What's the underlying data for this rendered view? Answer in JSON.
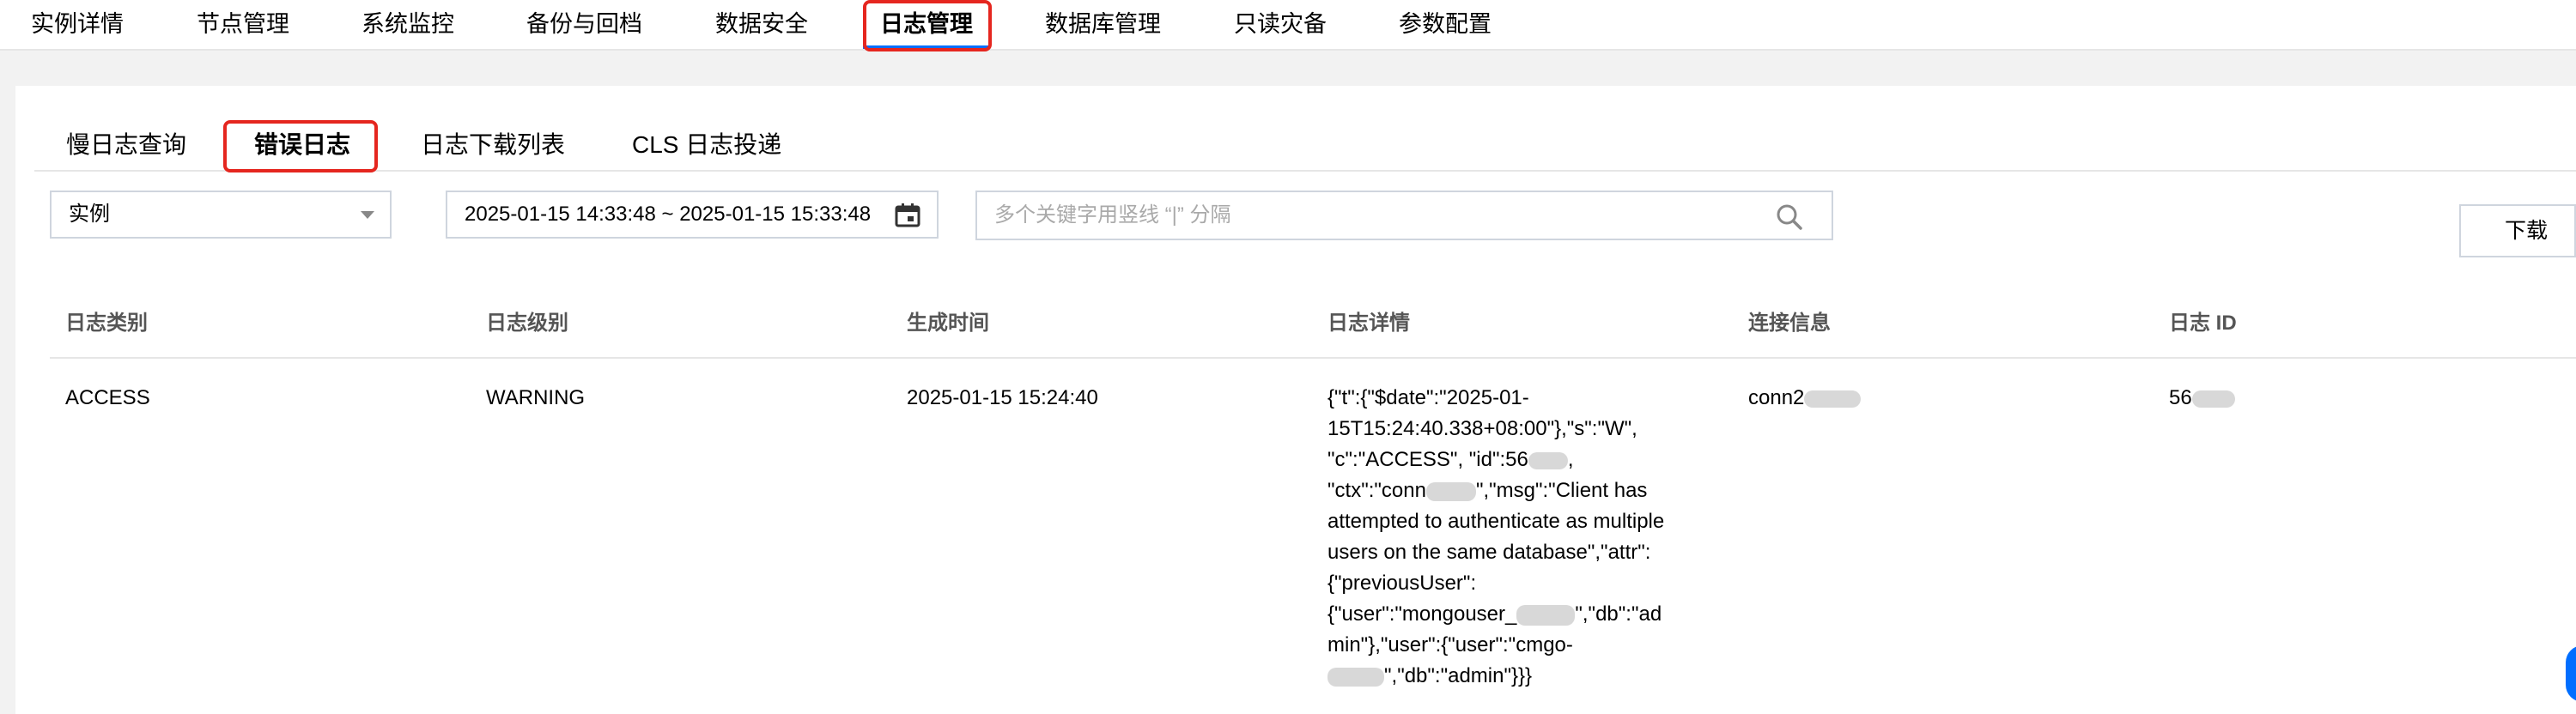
{
  "top_nav": {
    "items": [
      "实例详情",
      "节点管理",
      "系统监控",
      "备份与回档",
      "数据安全",
      "日志管理",
      "数据库管理",
      "只读灾备",
      "参数配置"
    ],
    "active_index": 5
  },
  "sub_tabs": {
    "items": [
      "慢日志查询",
      "错误日志",
      "日志下载列表",
      "CLS 日志投递"
    ],
    "active_index": 1
  },
  "filters": {
    "instance_select": "实例",
    "date_range": "2025-01-15 14:33:48 ~ 2025-01-15 15:33:48",
    "search_placeholder": "多个关键字用竖线 “|” 分隔",
    "download_label": "下载"
  },
  "table": {
    "headers": [
      "日志类别",
      "日志级别",
      "生成时间",
      "日志详情",
      "连接信息",
      "日志 ID"
    ],
    "rows": [
      {
        "category": "ACCESS",
        "level": "WARNING",
        "time": "2025-01-15 15:24:40",
        "detail_lines": [
          "{\"t\":{\"$date\":\"2025-01-",
          "15T15:24:40.338+08:00\"},\"s\":\"W\",",
          "\"c\":\"ACCESS\", \"id\":56",
          "\"ctx\":\"conn",
          "attempted to authenticate as multiple",
          "users on the same database\",\"attr\":",
          "{\"previousUser\":",
          "{\"user\":\"mongouser_",
          "min\"},\"user\":{\"user\":\"cmgo-",
          "\",\"db\":\"admin\"}}}"
        ],
        "detail_line_tails": [
          "",
          "",
          ",",
          "\",\"msg\":\"Client has",
          "",
          "",
          "",
          "\",\"db\":\"ad",
          "",
          ""
        ],
        "connection": "conn2",
        "log_id": "56"
      }
    ]
  },
  "colors": {
    "active_underline": "#006eff",
    "highlight_box": "#e5261f",
    "page_bg": "#f2f2f2"
  },
  "icons": {
    "select_caret": "caret-down-icon",
    "calendar": "calendar-icon",
    "search": "search-icon"
  }
}
